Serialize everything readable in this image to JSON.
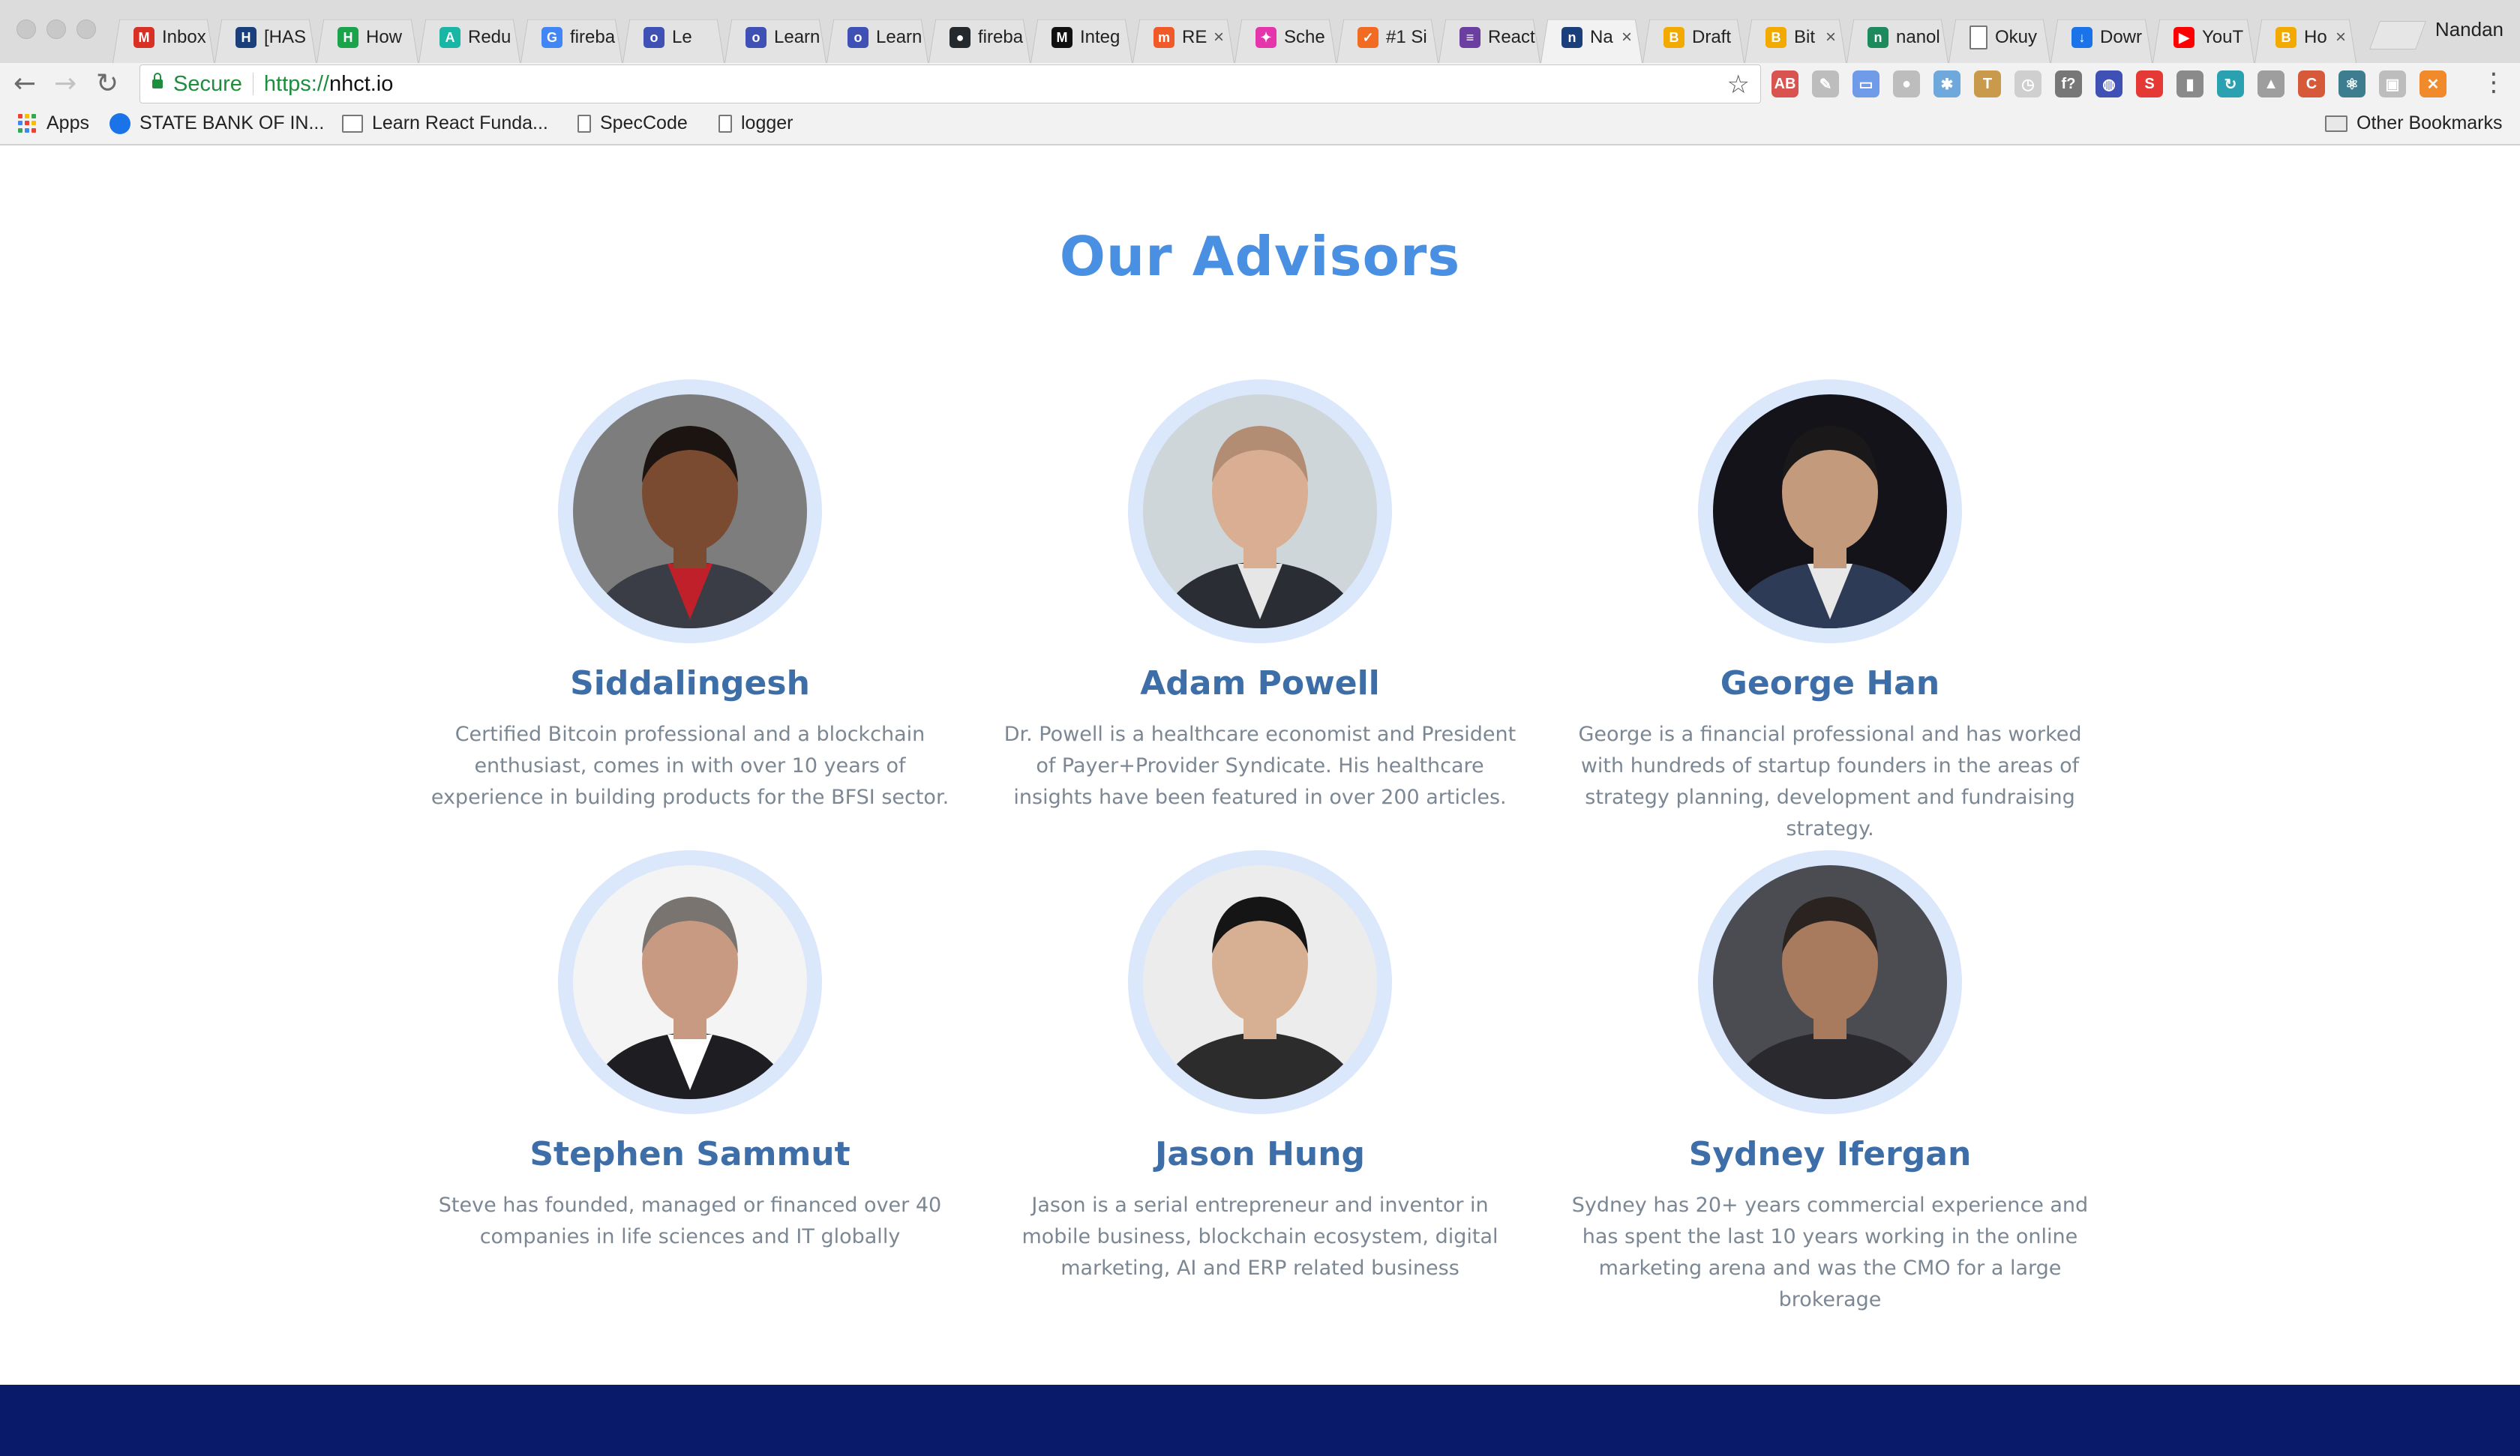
{
  "browser": {
    "profile_name": "Nandan",
    "tabs": [
      {
        "label": "Inbox",
        "icon": "gmail-icon",
        "color": "#d93025",
        "glyph": "M"
      },
      {
        "label": "[HAS",
        "icon": "hasura-icon",
        "color": "#1a3f7a",
        "glyph": "H"
      },
      {
        "label": "How",
        "icon": "how-icon",
        "color": "#1aa34a",
        "glyph": "H"
      },
      {
        "label": "Redu",
        "icon": "redux-icon",
        "color": "#19b5a5",
        "glyph": "A"
      },
      {
        "label": "fireba",
        "icon": "google-icon",
        "color": "#4285f4",
        "glyph": "G"
      },
      {
        "label": "Le",
        "icon": "eye-icon",
        "color": "#3f51b5",
        "glyph": "o"
      },
      {
        "label": "Learn",
        "icon": "eye-icon",
        "color": "#3f51b5",
        "glyph": "o"
      },
      {
        "label": "Learn",
        "icon": "eye-icon",
        "color": "#3f51b5",
        "glyph": "o"
      },
      {
        "label": "fireba",
        "icon": "github-icon",
        "color": "#24292e",
        "glyph": "●"
      },
      {
        "label": "Integ",
        "icon": "medium-icon",
        "color": "#111111",
        "glyph": "M"
      },
      {
        "label": "RE",
        "icon": "m-icon",
        "color": "#f05a28",
        "glyph": "m"
      },
      {
        "label": "Sche",
        "icon": "graphql-icon",
        "color": "#e535ab",
        "glyph": "✦"
      },
      {
        "label": "#1 Si",
        "icon": "check-icon",
        "color": "#f26b22",
        "glyph": "✓"
      },
      {
        "label": "React",
        "icon": "list-icon",
        "color": "#6b3fa0",
        "glyph": "≡"
      },
      {
        "label": "Na",
        "icon": "nhct-icon",
        "color": "#1a3f7a",
        "glyph": "n"
      },
      {
        "label": "Draft",
        "icon": "bitcoin-icon",
        "color": "#f2a900",
        "glyph": "B"
      },
      {
        "label": "Bit",
        "icon": "bitcoin-icon",
        "color": "#f2a900",
        "glyph": "B"
      },
      {
        "label": "nanol",
        "icon": "nano-icon",
        "color": "#1d8a5e",
        "glyph": "n"
      },
      {
        "label": "Okuy",
        "icon": "page-icon",
        "color": "#ffffff",
        "glyph": ""
      },
      {
        "label": "Dowr",
        "icon": "download-icon",
        "color": "#1a73e8",
        "glyph": "↓"
      },
      {
        "label": "YouT",
        "icon": "youtube-icon",
        "color": "#ff0000",
        "glyph": "▶"
      },
      {
        "label": "Ho",
        "icon": "bitcoin-icon",
        "color": "#f2a900",
        "glyph": "B"
      }
    ],
    "address": {
      "secure_label": "Secure",
      "url_scheme": "https://",
      "url_host": "nhct.io"
    },
    "extensions": [
      {
        "name": "adblock-icon",
        "color": "#d9534f",
        "glyph": "AB"
      },
      {
        "name": "edit-icon",
        "color": "#bdbdbd",
        "glyph": "✎"
      },
      {
        "name": "window-icon",
        "color": "#6f9be8",
        "glyph": "▭"
      },
      {
        "name": "circle-icon",
        "color": "#bdbdbd",
        "glyph": "●"
      },
      {
        "name": "bug-icon",
        "color": "#6fa8dc",
        "glyph": "✱"
      },
      {
        "name": "hammer-icon",
        "color": "#c99a4b",
        "glyph": "T"
      },
      {
        "name": "clock-icon",
        "color": "#cfcfcf",
        "glyph": "◷"
      },
      {
        "name": "function-icon",
        "color": "#777777",
        "glyph": "f?"
      },
      {
        "name": "globe-icon",
        "color": "#3f51b5",
        "glyph": "◍"
      },
      {
        "name": "s-icon",
        "color": "#e53935",
        "glyph": "S"
      },
      {
        "name": "bar-icon",
        "color": "#8a8a8a",
        "glyph": "▮"
      },
      {
        "name": "refresh-circle-icon",
        "color": "#2aa1b0",
        "glyph": "↻"
      },
      {
        "name": "drive-icon",
        "color": "#9e9e9e",
        "glyph": "▲"
      },
      {
        "name": "cors-icon",
        "color": "#d65a3a",
        "glyph": "C"
      },
      {
        "name": "react-icon",
        "color": "#3d7d8f",
        "glyph": "⚛"
      },
      {
        "name": "reader-icon",
        "color": "#bdbdbd",
        "glyph": "▣"
      },
      {
        "name": "orange-x-icon",
        "color": "#f08a2a",
        "glyph": "✕"
      }
    ],
    "bookmarks": {
      "apps": "Apps",
      "items": [
        {
          "label": "STATE BANK OF IN...",
          "icon": "sbi-icon"
        },
        {
          "label": "Learn React Funda...",
          "icon": "page-icon"
        },
        {
          "label": "SpecCode",
          "icon": "page-icon"
        },
        {
          "label": "logger",
          "icon": "page-icon"
        }
      ],
      "other": "Other Bookmarks"
    }
  },
  "section": {
    "title": "Our Advisors"
  },
  "advisors": [
    {
      "name": "Siddalingesh",
      "bio": "Certified Bitcoin professional and a blockchain enthusiast, comes in with over 10 years of experience in building products for the BFSI sector.",
      "bg": "#7d7d7d",
      "skin": "#7a4b30",
      "hair": "#1b1410",
      "suit": "#3a3d45",
      "accent": "#c0202a"
    },
    {
      "name": "Adam Powell",
      "bio": "Dr. Powell is a healthcare economist and President of Payer+Provider Syndicate. His healthcare insights have been featured in over 200 articles.",
      "bg": "#cfd6da",
      "skin": "#d9ae92",
      "hair": "#b28d74",
      "suit": "#2a2d33",
      "accent": "#e6e6e6"
    },
    {
      "name": "George Han",
      "bio": "George is a financial professional and has worked with hundreds of startup founders in the areas of strategy planning, development and fundraising strategy.",
      "bg": "#14131a",
      "skin": "#c49a7c",
      "hair": "#1a1818",
      "suit": "#2e3b56",
      "accent": "#e8e8e8"
    },
    {
      "name": "Stephen Sammut",
      "bio": "Steve has founded, managed or financed over 40 companies in life sciences and IT globally",
      "bg": "#f4f4f4",
      "skin": "#c99a82",
      "hair": "#7a7470",
      "suit": "#1e1e22",
      "accent": "#ffffff"
    },
    {
      "name": "Jason Hung",
      "bio": "Jason is a serial entrepreneur and inventor in mobile business, blockchain ecosystem, digital marketing, AI and ERP related business",
      "bg": "#ececec",
      "skin": "#d7b093",
      "hair": "#151515",
      "suit": "#2c2c2c",
      "accent": "#2c2c2c"
    },
    {
      "name": "Sydney Ifergan",
      "bio": "Sydney has 20+ years commercial experience and has spent the last 10 years working in the online marketing arena and was the CMO for a large brokerage",
      "bg": "#4a4c52",
      "skin": "#a87a5e",
      "hair": "#2a2320",
      "suit": "#2a2a2e",
      "accent": "#2a2a2e"
    }
  ]
}
